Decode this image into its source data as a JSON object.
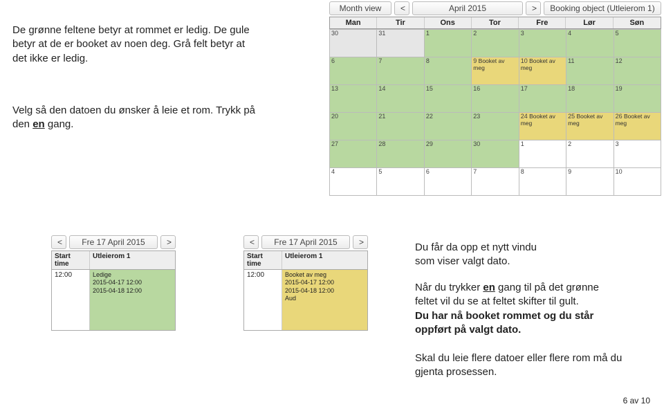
{
  "instr1_l1": "De grønne feltene betyr at rommet er ledig. De gule",
  "instr1_l2": "betyr at de er booket av noen deg. Grå felt betyr at",
  "instr1_l3": "det ikke er ledig.",
  "instr2_l1": "Velg så den datoen du ønsker å leie et rom. Trykk på",
  "instr2_l2a": "den ",
  "instr2_l2b": "en",
  "instr2_l2c": " gang.",
  "instr3_l1": "Du får da opp et nytt vindu",
  "instr3_l2": "som viser valgt dato.",
  "instr4_l1a": "Når du trykker ",
  "instr4_l1b": "en",
  "instr4_l1c": " gang til på det grønne",
  "instr4_l2": "feltet vil du se at feltet skifter til gult.",
  "instr4_l3": "Du har nå booket rommet og du står",
  "instr4_l4": "oppført på valgt dato.",
  "instr5_l1": "Skal du leie flere datoer eller flere rom må du",
  "instr5_l2": "gjenta prosessen.",
  "page_num": "6 av 10",
  "tb": {
    "month_view": "Month view",
    "prev": "<",
    "next": ">",
    "month": "April 2015",
    "booking_obj": "Booking object (Utleierom 1)"
  },
  "days": [
    "Man",
    "Tir",
    "Ons",
    "Tor",
    "Fre",
    "Lør",
    "Søn"
  ],
  "cells": [
    {
      "n": "30",
      "c": "grey"
    },
    {
      "n": "31",
      "c": "grey"
    },
    {
      "n": "1",
      "c": "green"
    },
    {
      "n": "2",
      "c": "green"
    },
    {
      "n": "3",
      "c": "green"
    },
    {
      "n": "4",
      "c": "green"
    },
    {
      "n": "5",
      "c": "green"
    },
    {
      "n": "6",
      "c": "green"
    },
    {
      "n": "7",
      "c": "green"
    },
    {
      "n": "8",
      "c": "green"
    },
    {
      "n": "9",
      "c": "yellow",
      "t": "Booket av meg"
    },
    {
      "n": "10",
      "c": "yellow",
      "t": "Booket av meg"
    },
    {
      "n": "11",
      "c": "green"
    },
    {
      "n": "12",
      "c": "green"
    },
    {
      "n": "13",
      "c": "green"
    },
    {
      "n": "14",
      "c": "green"
    },
    {
      "n": "15",
      "c": "green"
    },
    {
      "n": "16",
      "c": "green"
    },
    {
      "n": "17",
      "c": "green"
    },
    {
      "n": "18",
      "c": "green"
    },
    {
      "n": "19",
      "c": "green"
    },
    {
      "n": "20",
      "c": "green"
    },
    {
      "n": "21",
      "c": "green"
    },
    {
      "n": "22",
      "c": "green"
    },
    {
      "n": "23",
      "c": "green"
    },
    {
      "n": "24",
      "c": "yellow",
      "t": "Booket av meg"
    },
    {
      "n": "25",
      "c": "yellow",
      "t": "Booket av meg"
    },
    {
      "n": "26",
      "c": "yellow",
      "t": "Booket av meg"
    },
    {
      "n": "27",
      "c": "green"
    },
    {
      "n": "28",
      "c": "green"
    },
    {
      "n": "29",
      "c": "green"
    },
    {
      "n": "30",
      "c": "green"
    },
    {
      "n": "1",
      "c": "white"
    },
    {
      "n": "2",
      "c": "white"
    },
    {
      "n": "3",
      "c": "white"
    },
    {
      "n": "4",
      "c": "white"
    },
    {
      "n": "5",
      "c": "white"
    },
    {
      "n": "6",
      "c": "white"
    },
    {
      "n": "7",
      "c": "white"
    },
    {
      "n": "8",
      "c": "white"
    },
    {
      "n": "9",
      "c": "white"
    },
    {
      "n": "10",
      "c": "white"
    }
  ],
  "day1": {
    "title": "Fre 17 April 2015",
    "h1": "Start time",
    "h2": "Utleierom 1",
    "time": "12:00",
    "slot_l1": "Ledige",
    "slot_l2": "2015-04-17 12:00",
    "slot_l3": "2015-04-18 12:00"
  },
  "day2": {
    "title": "Fre 17 April 2015",
    "h1": "Start time",
    "h2": "Utleierom 1",
    "time": "12:00",
    "slot_l1": "Booket av meg",
    "slot_l2": "2015-04-17 12:00",
    "slot_l3": "2015-04-18 12:00",
    "slot_l4": "Aud"
  }
}
